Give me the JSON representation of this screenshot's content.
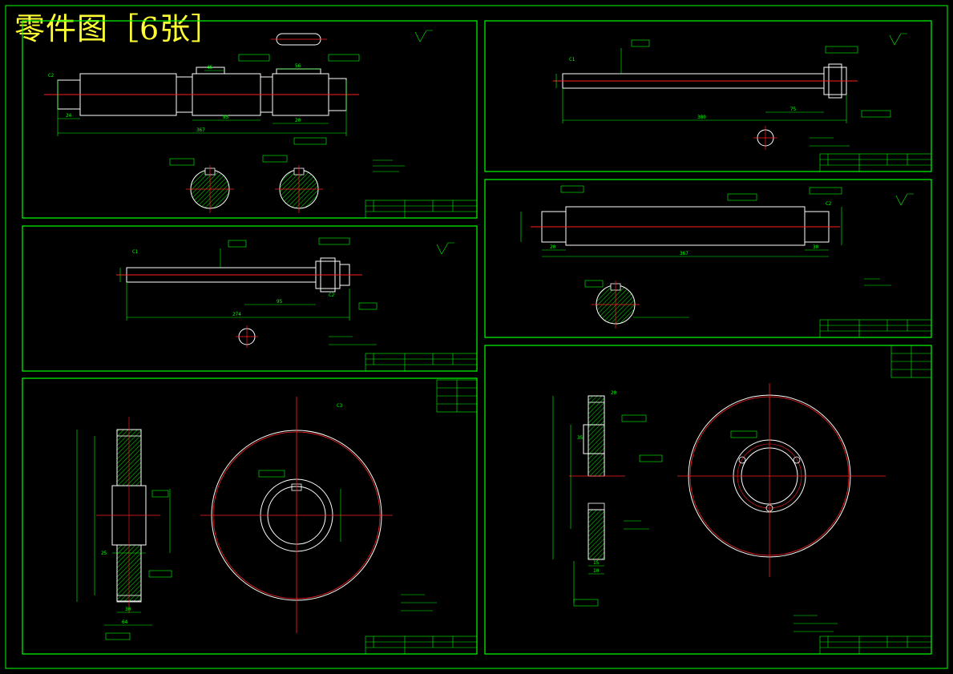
{
  "banner": {
    "title": "零件图［6张］"
  },
  "colors": {
    "background": "#000000",
    "border": "#00ff00",
    "outline": "#ffffff",
    "centerline": "#ff2020",
    "dimension": "#00ff00",
    "hatch": "#00cc00",
    "banner_text": "#ffff33"
  },
  "sheets": [
    {
      "dims": [
        "24",
        "85",
        "367",
        "45",
        "56",
        "20",
        "C2"
      ]
    },
    {
      "dims": [
        "274",
        "95",
        "C1",
        "C2"
      ]
    },
    {
      "dims": [
        "64",
        "30",
        "25",
        "C3"
      ]
    },
    {
      "dims": [
        "380",
        "75",
        "C1"
      ]
    },
    {
      "dims": [
        "367",
        "20",
        "30",
        "C2"
      ]
    },
    {
      "dims": [
        "15",
        "10",
        "35",
        "20"
      ]
    }
  ]
}
